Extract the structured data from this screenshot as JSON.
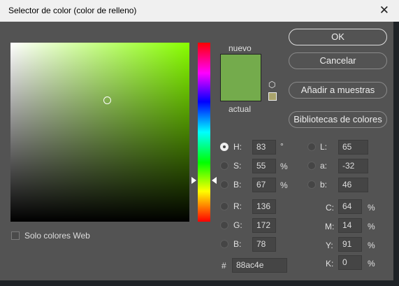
{
  "title": "Selector de color (color de relleno)",
  "buttons": {
    "ok": "OK",
    "cancel": "Cancelar",
    "add": "Añadir a muestras",
    "libraries": "Bibliotecas de colores"
  },
  "swatch": {
    "new_label": "nuevo",
    "current_label": "actual",
    "new_color": "#74ab4c",
    "current_color": "#74ab4c",
    "gamut_color": "#a9a46c"
  },
  "web_only": {
    "label": "Solo colores Web",
    "checked": false
  },
  "hsb": [
    {
      "label": "H:",
      "value": "83",
      "unit": "°",
      "selected": true
    },
    {
      "label": "S:",
      "value": "55",
      "unit": "%"
    },
    {
      "label": "B:",
      "value": "67",
      "unit": "%"
    }
  ],
  "lab": [
    {
      "label": "L:",
      "value": "65"
    },
    {
      "label": "a:",
      "value": "-32"
    },
    {
      "label": "b:",
      "value": "46"
    }
  ],
  "rgb": [
    {
      "label": "R:",
      "value": "136"
    },
    {
      "label": "G:",
      "value": "172"
    },
    {
      "label": "B:",
      "value": "78"
    }
  ],
  "cmyk": [
    {
      "label": "C:",
      "value": "64",
      "unit": "%"
    },
    {
      "label": "M:",
      "value": "14",
      "unit": "%"
    },
    {
      "label": "Y:",
      "value": "91",
      "unit": "%"
    },
    {
      "label": "K:",
      "value": "0",
      "unit": "%"
    }
  ],
  "hex": {
    "label": "#",
    "value": "88ac4e"
  }
}
